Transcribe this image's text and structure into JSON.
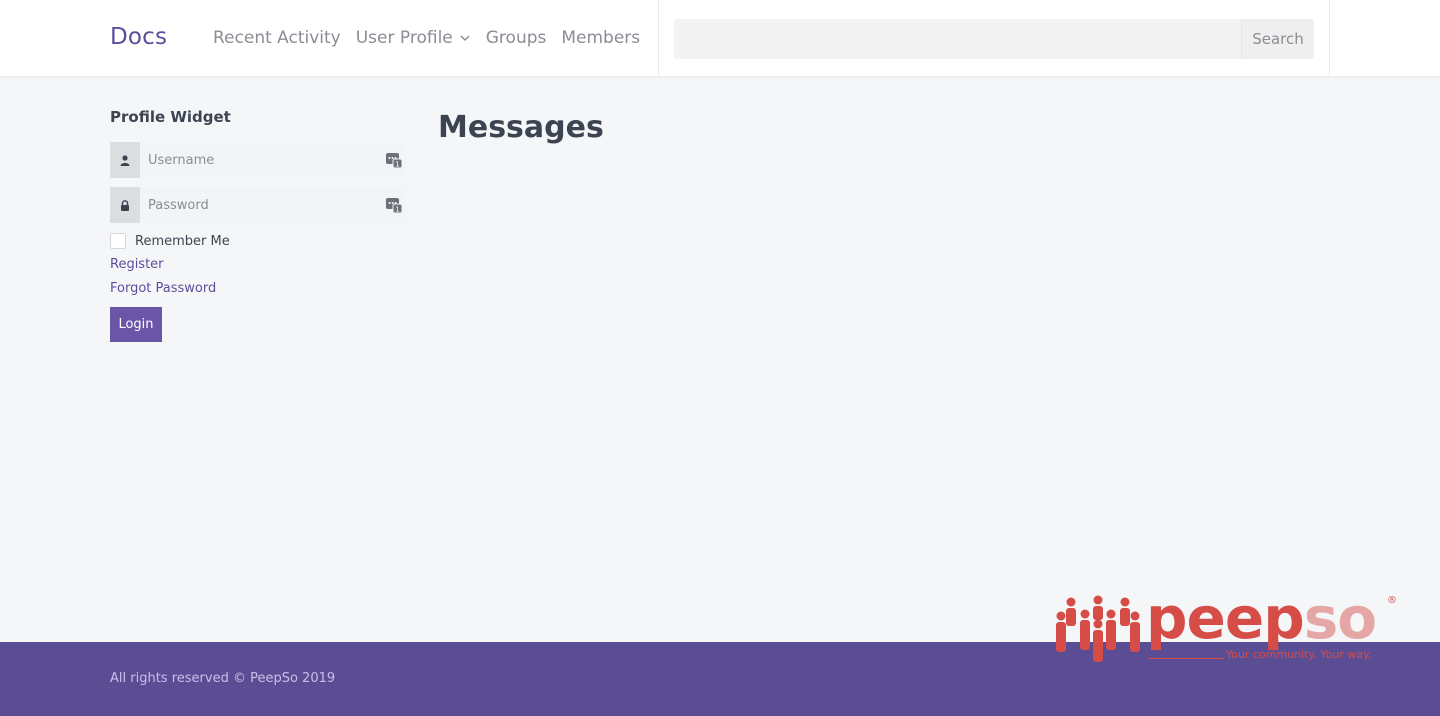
{
  "header": {
    "brand": "Docs",
    "nav": [
      {
        "label": "Recent Activity"
      },
      {
        "label": "User Profile"
      },
      {
        "label": "Groups"
      },
      {
        "label": "Members"
      }
    ],
    "search": {
      "placeholder": "",
      "button_label": "Search"
    }
  },
  "widget": {
    "title": "Profile Widget",
    "username_placeholder": "Username",
    "password_placeholder": "Password",
    "remember_label": "Remember Me",
    "register_label": "Register",
    "forgot_label": "Forgot Password",
    "login_label": "Login"
  },
  "main": {
    "title": "Messages"
  },
  "footer": {
    "copyright": "All rights reserved © PeepSo 2019"
  },
  "logo": {
    "peep": "peep",
    "so": "so",
    "registered": "®",
    "tagline": "Your community. Your way."
  },
  "colors": {
    "accent": "#5d4e9c",
    "footer": "#5b4d94",
    "login_button": "#6b55a8",
    "logo_red": "#d64c46"
  },
  "icons": [
    "user-icon",
    "lock-icon",
    "password-manager-icon",
    "chevron-down-icon",
    "peepso-people-icon"
  ]
}
